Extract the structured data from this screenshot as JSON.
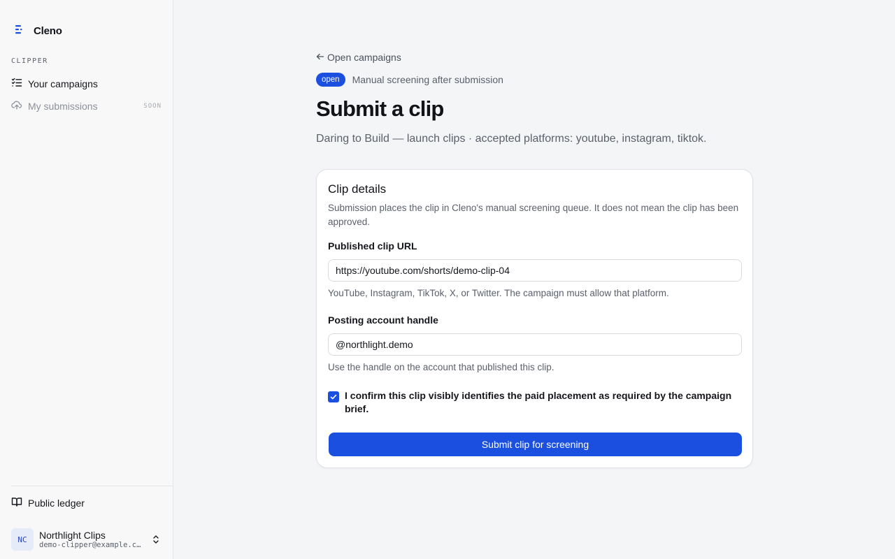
{
  "app": {
    "name": "Cleno"
  },
  "sidebar": {
    "section_label": "CLIPPER",
    "items": [
      {
        "label": "Your campaigns",
        "icon": "list-check-icon",
        "active": true
      },
      {
        "label": "My submissions",
        "icon": "cloud-upload-icon",
        "badge": "SOON",
        "disabled": true
      }
    ],
    "ledger": {
      "label": "Public ledger",
      "icon": "book-icon"
    },
    "account": {
      "initials": "NC",
      "name": "Northlight Clips",
      "email": "demo-clipper@example.com"
    }
  },
  "page": {
    "back_link": "Open campaigns",
    "status_badge": "open",
    "status_text": "Manual screening after submission",
    "title": "Submit a clip",
    "subtitle": "Daring to Build — launch clips · accepted platforms: youtube, instagram, tiktok."
  },
  "form": {
    "card_title": "Clip details",
    "card_description": "Submission places the clip in Cleno's manual screening queue. It does not mean the clip has been approved.",
    "url": {
      "label": "Published clip URL",
      "value": "https://youtube.com/shorts/demo-clip-04",
      "hint": "YouTube, Instagram, TikTok, X, or Twitter. The campaign must allow that platform."
    },
    "handle": {
      "label": "Posting account handle",
      "value": "@northlight.demo",
      "hint": "Use the handle on the account that published this clip."
    },
    "confirm": {
      "checked": true,
      "label": "I confirm this clip visibly identifies the paid placement as required by the campaign brief."
    },
    "submit_label": "Submit clip for screening"
  },
  "colors": {
    "accent": "#1a4fe0",
    "text": "#111318",
    "muted": "#5b606b"
  }
}
